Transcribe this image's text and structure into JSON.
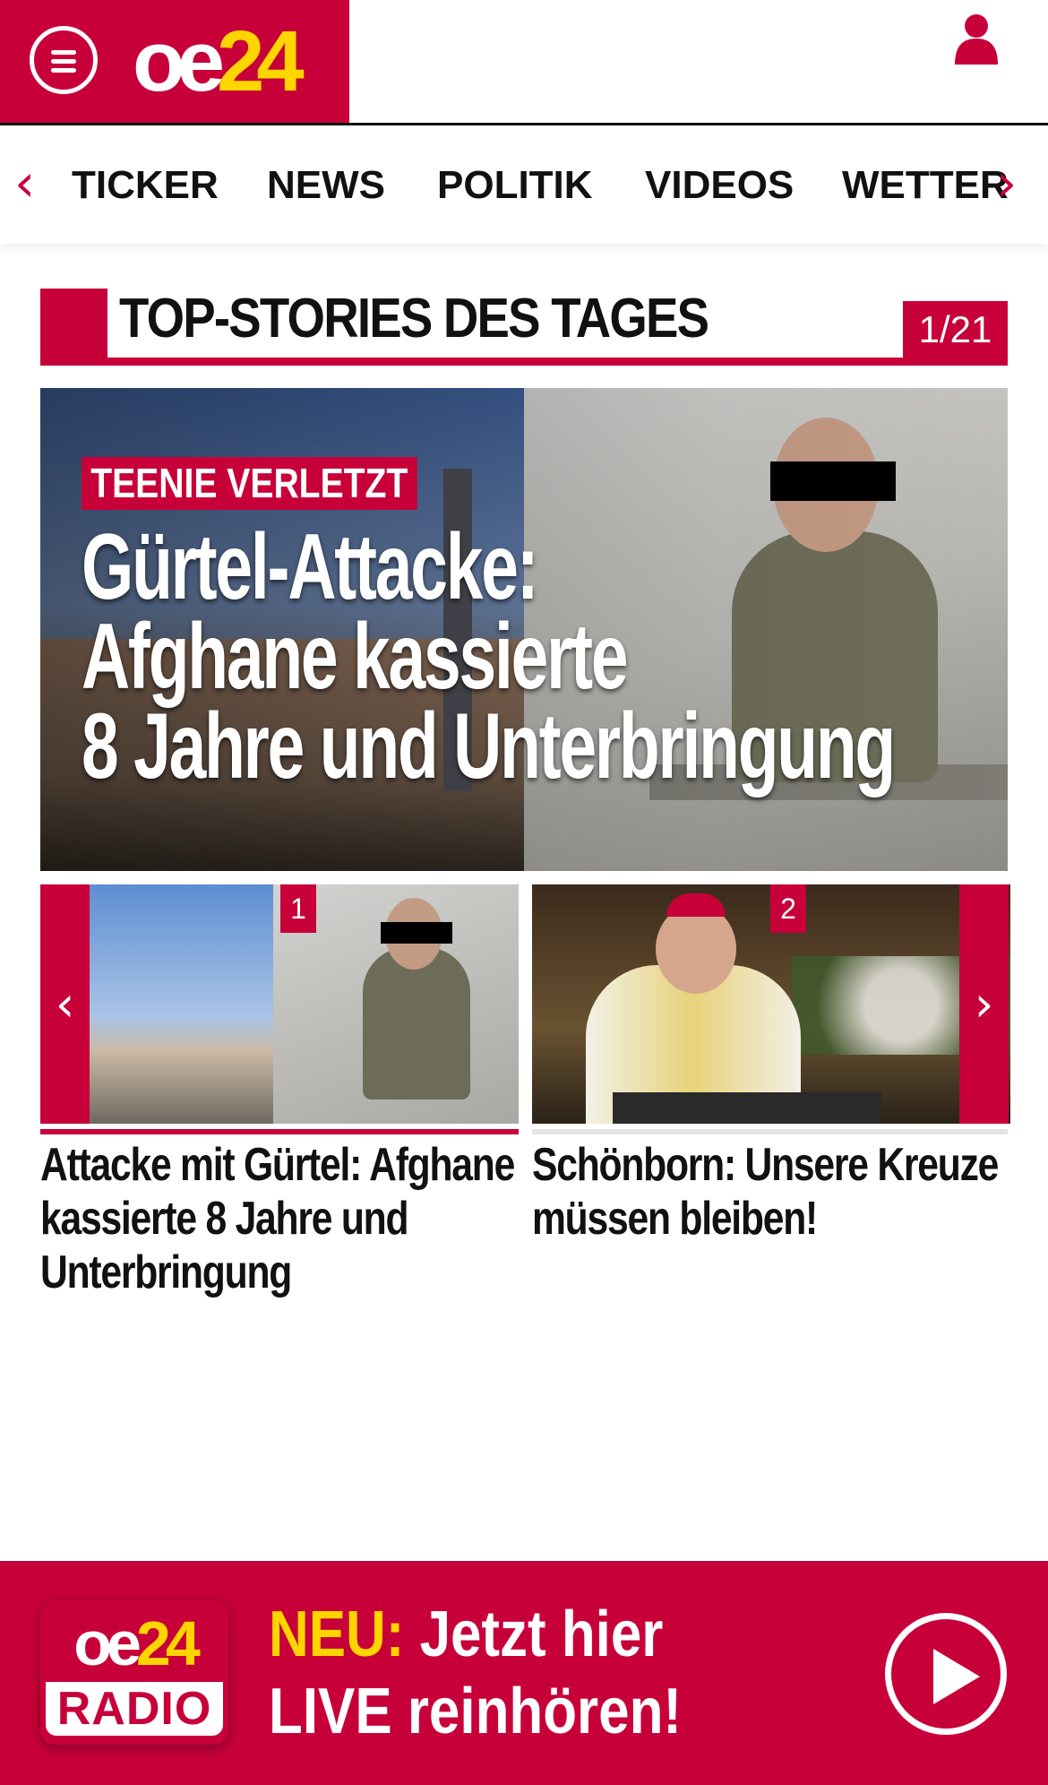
{
  "header": {
    "logo": {
      "oe": "oe",
      "num": "24"
    },
    "colors": {
      "brand": "#c8003a",
      "accent": "#ffd500"
    }
  },
  "nav": {
    "items": [
      {
        "label": "TICKER"
      },
      {
        "label": "NEWS"
      },
      {
        "label": "POLITIK"
      },
      {
        "label": "VIDEOS"
      },
      {
        "label": "WETTER"
      }
    ],
    "prev_icon": "‹",
    "next_icon": "›"
  },
  "section": {
    "title": "TOP-STORIES DES TAGES",
    "counter": "1/21"
  },
  "hero": {
    "kicker": "TEENIE VERLETZT",
    "headline_lines": [
      "Gürtel-Attacke:",
      "Afghane kassierte",
      "8 Jahre und Unterbringung"
    ]
  },
  "cards": [
    {
      "number": "1",
      "title": "Attacke mit Gürtel: Afghane kassierte 8 Jahre und Unterbringung",
      "active": true
    },
    {
      "number": "2",
      "title": "Schönborn: Unsere Kreuze müssen bleiben!",
      "active": false
    }
  ],
  "carousel": {
    "prev_icon": "‹",
    "next_icon": "›"
  },
  "radio": {
    "logo_oe": "oe",
    "logo_num": "24",
    "logo_tag": "RADIO",
    "line1_highlight": "NEU:",
    "line1_rest": " Jetzt hier",
    "line2": "LIVE reinhören!"
  }
}
